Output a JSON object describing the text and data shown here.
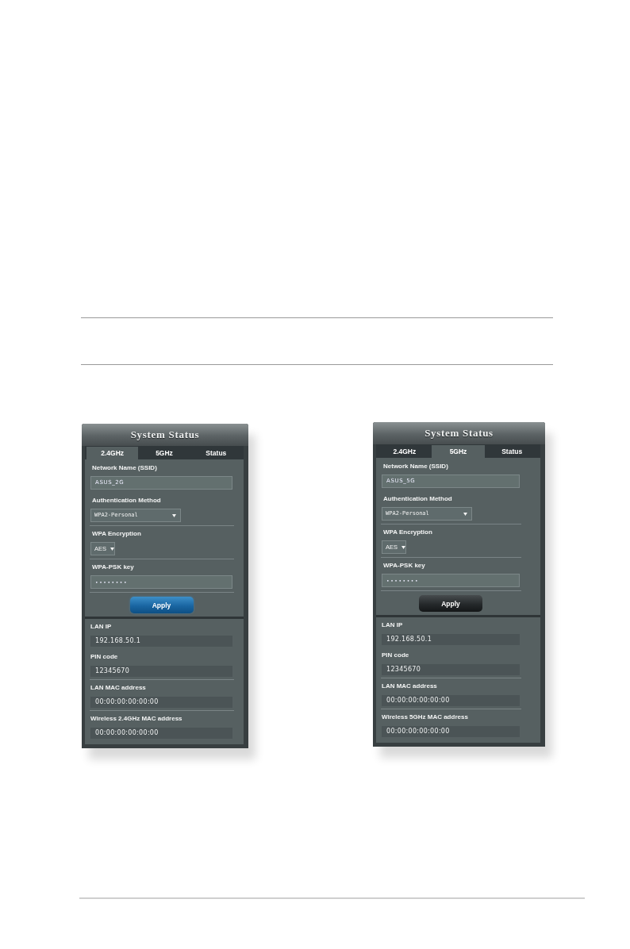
{
  "panels": [
    {
      "title": "System Status",
      "tabs": [
        {
          "label": "2.4GHz",
          "selected": true
        },
        {
          "label": "5GHz",
          "selected": false
        },
        {
          "label": "Status",
          "selected": false
        }
      ],
      "fields": [
        {
          "kind": "text",
          "label": "Network Name (SSID)",
          "value": "ASUS_2G"
        },
        {
          "kind": "dropdown",
          "label": "Authentication Method",
          "value": "WPA2-Personal"
        },
        {
          "kind": "mini-dropdown",
          "label": "WPA Encryption",
          "value": "AES"
        },
        {
          "kind": "secret",
          "label": "WPA-PSK key",
          "value": "••••••••"
        }
      ],
      "apply_button": {
        "label": "Apply",
        "highlighted": true
      },
      "info": [
        {
          "label": "LAN IP",
          "value": "192.168.50.1"
        },
        {
          "label": "PIN code",
          "value": "12345670"
        },
        {
          "label": "LAN MAC address",
          "value": "00:00:00:00:00:00"
        },
        {
          "label": "Wireless 2.4GHz MAC address",
          "value": "00:00:00:00:00:00"
        }
      ]
    },
    {
      "title": "System Status",
      "tabs": [
        {
          "label": "2.4GHz",
          "selected": false
        },
        {
          "label": "5GHz",
          "selected": true
        },
        {
          "label": "Status",
          "selected": false
        }
      ],
      "fields": [
        {
          "kind": "text",
          "label": "Network Name (SSID)",
          "value": "ASUS_5G"
        },
        {
          "kind": "dropdown",
          "label": "Authentication Method",
          "value": "WPA2-Personal"
        },
        {
          "kind": "mini-dropdown",
          "label": "WPA Encryption",
          "value": "AES"
        },
        {
          "kind": "secret",
          "label": "WPA-PSK key",
          "value": "••••••••"
        }
      ],
      "apply_button": {
        "label": "Apply",
        "highlighted": false
      },
      "info": [
        {
          "label": "LAN IP",
          "value": "192.168.50.1"
        },
        {
          "label": "PIN code",
          "value": "12345670"
        },
        {
          "label": "LAN MAC address",
          "value": "00:00:00:00:00:00"
        },
        {
          "label": "Wireless 5GHz MAC address",
          "value": "00:00:00:00:00:00"
        }
      ]
    }
  ]
}
